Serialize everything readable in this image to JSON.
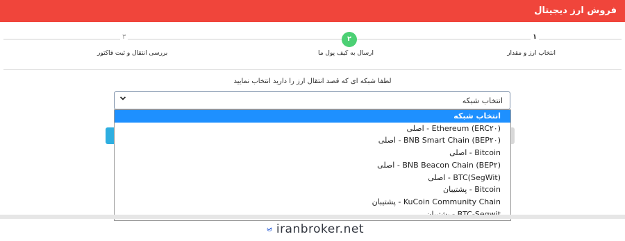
{
  "header": {
    "title": "فروش ارز دیجیتال",
    "background_color": "#f0453b"
  },
  "steps": [
    {
      "number": "۱",
      "label": "انتخاب ارز و مقدار",
      "state": "done"
    },
    {
      "number": "۲",
      "label": "ارسال به کیف پول ما",
      "state": "active",
      "color": "#4cd074"
    },
    {
      "number": "۳",
      "label": "بررسی انتقال و ثبت فاکتور",
      "state": "pending"
    }
  ],
  "network_select": {
    "instruction": "لطفا شبکه ای که قصد انتقال ارز را دارید انتخاب نمایید",
    "value": "انتخاب شبکه",
    "caret_icon": "chevron-down-icon",
    "options": [
      "انتخاب شبکه",
      "Ethereum (ERC۲۰) - اصلی",
      "BNB Smart Chain (BEP۲۰) - اصلی",
      "Bitcoin - اصلی",
      "BNB Beacon Chain (BEP۲) - اصلی",
      "BTC(SegWit) - اصلی",
      "Bitcoin - پشتیبان",
      "KuCoin Community Chain - پشتیبان",
      "BTC-Segwit - پشتیبان"
    ],
    "highlighted_index": 0,
    "highlight_color": "#1e90ff"
  },
  "watermark": {
    "text": "iranbroker.net",
    "icon": "trend-chart-icon",
    "color": "#2d5fd6"
  }
}
